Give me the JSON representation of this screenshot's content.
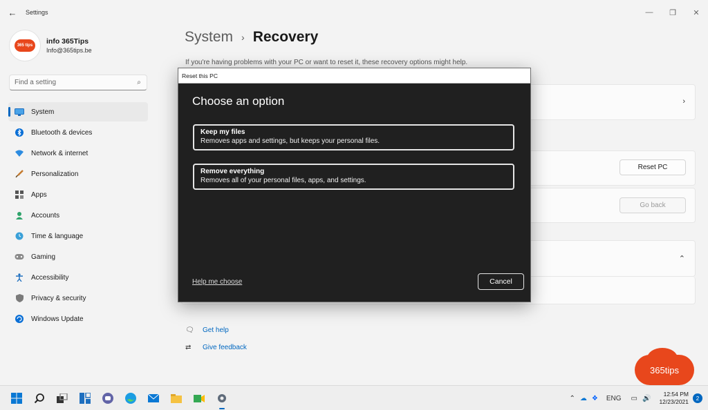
{
  "window": {
    "title": "Settings",
    "controls": {
      "minimize_icon": "minimize-icon",
      "maximize_icon": "restore-icon",
      "close_icon": "close-icon"
    }
  },
  "profile": {
    "name": "info 365Tips",
    "email": "Info@365tips.be",
    "avatar_text": "365 tips"
  },
  "search": {
    "placeholder": "Find a setting"
  },
  "sidebar": {
    "items": [
      {
        "label": "System",
        "icon": "monitor-icon",
        "active": true
      },
      {
        "label": "Bluetooth & devices",
        "icon": "bluetooth-icon"
      },
      {
        "label": "Network & internet",
        "icon": "wifi-icon"
      },
      {
        "label": "Personalization",
        "icon": "brush-icon"
      },
      {
        "label": "Apps",
        "icon": "apps-icon"
      },
      {
        "label": "Accounts",
        "icon": "person-icon"
      },
      {
        "label": "Time & language",
        "icon": "globe-clock-icon"
      },
      {
        "label": "Gaming",
        "icon": "gamepad-icon"
      },
      {
        "label": "Accessibility",
        "icon": "accessibility-icon"
      },
      {
        "label": "Privacy & security",
        "icon": "shield-icon"
      },
      {
        "label": "Windows Update",
        "icon": "update-icon"
      }
    ]
  },
  "main": {
    "breadcrumb": {
      "parent": "System",
      "separator": "›",
      "current": "Recovery"
    },
    "intro": "If you're having problems with your PC or want to reset it, these recovery options might help.",
    "reset_button": "Reset PC",
    "go_back_button": "Go back",
    "help_links": [
      {
        "label": "Get help",
        "icon": "help-chat-icon"
      },
      {
        "label": "Give feedback",
        "icon": "feedback-icon"
      }
    ]
  },
  "dialog": {
    "window_title": "Reset this PC",
    "heading": "Choose an option",
    "options": [
      {
        "title": "Keep my files",
        "description": "Removes apps and settings, but keeps your personal files."
      },
      {
        "title": "Remove everything",
        "description": "Removes all of your personal files, apps, and settings."
      }
    ],
    "help_link": "Help me choose",
    "cancel_button": "Cancel"
  },
  "watermark": {
    "text": "365tips"
  },
  "taskbar": {
    "apps": [
      "windows-start-icon",
      "search-icon",
      "task-view-icon",
      "widgets-icon",
      "teams-chat-icon",
      "edge-icon",
      "mail-icon",
      "file-explorer-icon",
      "meet-icon",
      "settings-icon"
    ],
    "tray": {
      "language": "ENG",
      "time": "12:54 PM",
      "date": "12/23/2021",
      "notifications": "2"
    }
  },
  "colors": {
    "accent": "#0067c0",
    "brand": "#e8471c",
    "dialog_bg": "#202020"
  }
}
